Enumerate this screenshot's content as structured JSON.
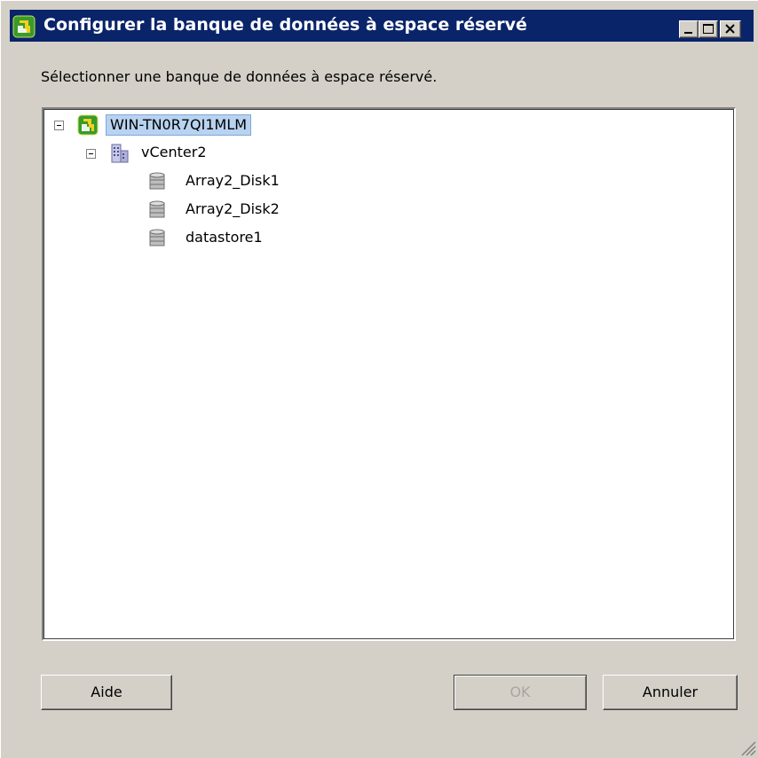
{
  "window": {
    "title": "Configurer la banque de données à espace réservé",
    "icon": "vsphere-icon"
  },
  "instruction": "Sélectionner une banque de données à espace réservé.",
  "tree": {
    "root": {
      "label": "WIN-TN0R7QI1MLM",
      "icon": "vsphere-icon",
      "expanded": true,
      "selected": true
    },
    "datacenter": {
      "label": "vCenter2",
      "icon": "datacenter-icon",
      "expanded": true
    },
    "datastores": [
      {
        "label": "Array2_Disk1",
        "icon": "datastore-icon"
      },
      {
        "label": "Array2_Disk2",
        "icon": "datastore-icon"
      },
      {
        "label": "datastore1",
        "icon": "datastore-icon"
      }
    ]
  },
  "buttons": {
    "help": "Aide",
    "ok": "OK",
    "cancel": "Annuler"
  },
  "colors": {
    "titlebar": "#0a246a",
    "selection": "#b8d3f0"
  }
}
